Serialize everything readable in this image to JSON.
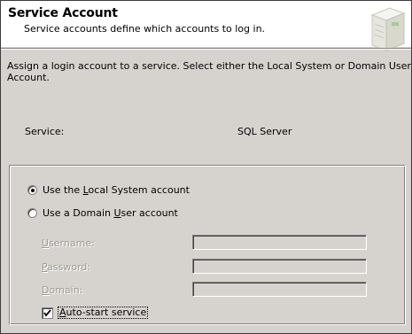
{
  "header": {
    "title": "Service Account",
    "subtitle": "Service accounts define which accounts to log in."
  },
  "instruction": "Assign a login account to a service. Select either the Local System or Domain User Account.",
  "service": {
    "label": "Service:",
    "value": "SQL Server"
  },
  "options": {
    "local_system": {
      "pre": "Use the ",
      "accel": "L",
      "post": "ocal System account",
      "selected": true
    },
    "domain_user": {
      "pre": "Use a Domain ",
      "accel": "U",
      "post": "ser account",
      "selected": false
    }
  },
  "fields": {
    "username": {
      "accel": "U",
      "rest": "sername:",
      "value": ""
    },
    "password": {
      "accel": "P",
      "rest": "assword:",
      "value": ""
    },
    "domain": {
      "accel": "D",
      "rest": "omain:",
      "value": ""
    }
  },
  "autostart": {
    "accel": "A",
    "rest": "uto-start service",
    "checked": true
  }
}
